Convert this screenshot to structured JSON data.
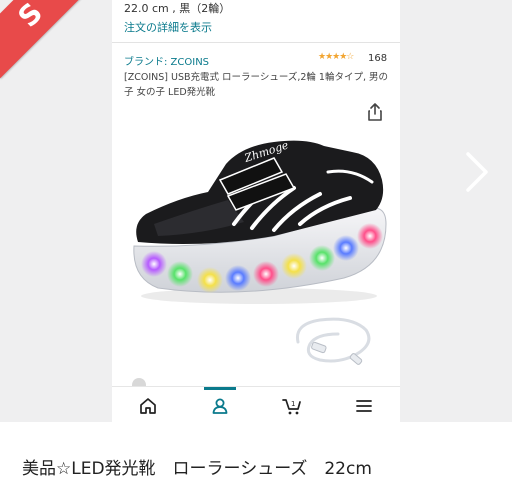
{
  "listing": {
    "sold_badge": "S",
    "caption": "美品☆LED発光靴　ローラーシューズ　22cm"
  },
  "product_screen": {
    "order_line": "22.0 cm , 黒（2輪）",
    "order_detail_link": "注文の詳細を表示",
    "brand_link": "ブランド: ZCOINS",
    "rating_stars": "★★★★☆",
    "rating_value": 4,
    "review_count": "168",
    "title": "[ZCOINS] USB充電式 ローラーシューズ,2輪 1輪タイプ, 男の子 女の子 LED発光靴",
    "image_alt": "LED light-up roller shoe with USB cable",
    "shoe_text": "Zhmoge"
  },
  "bottom_nav": {
    "items": [
      {
        "name": "home",
        "icon": "home-icon"
      },
      {
        "name": "account",
        "icon": "person-icon",
        "active": true
      },
      {
        "name": "cart",
        "icon": "cart-icon"
      },
      {
        "name": "menu",
        "icon": "menu-icon"
      }
    ]
  },
  "colors": {
    "accent": "#0a7a8c",
    "sold_ribbon": "#e84a4a",
    "stars": "#f2a531"
  }
}
